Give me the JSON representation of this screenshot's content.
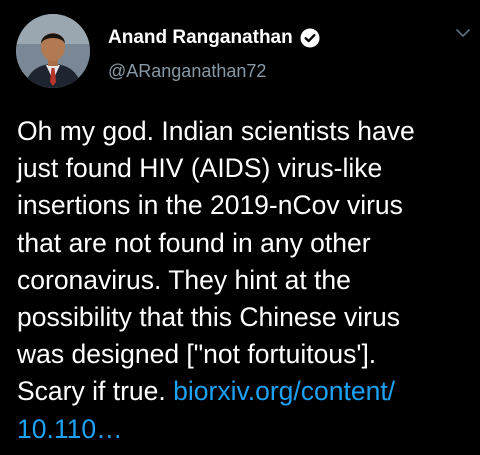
{
  "author": {
    "display_name": "Anand Ranganathan",
    "handle": "@ARanganathan72",
    "verified": true,
    "avatar_icon": "profile-photo"
  },
  "tweet": {
    "lines": [
      "Oh my god. Indian scientists have",
      "just found HIV (AIDS) virus-like",
      "insertions in the 2019-nCov virus",
      "that are not found in any other",
      "coronavirus. They hint at the",
      "possibility that this Chinese virus",
      "was designed [\"not fortuitous'].",
      "Scary if true."
    ],
    "link_part1": "biorxiv.org/content/",
    "link_part2": "10.110…"
  },
  "colors": {
    "background": "#000000",
    "text": "#ffffff",
    "secondary": "#8899a6",
    "link": "#1da1f2"
  },
  "icons": {
    "verified": "verified-badge-icon",
    "menu": "chevron-down-icon"
  }
}
